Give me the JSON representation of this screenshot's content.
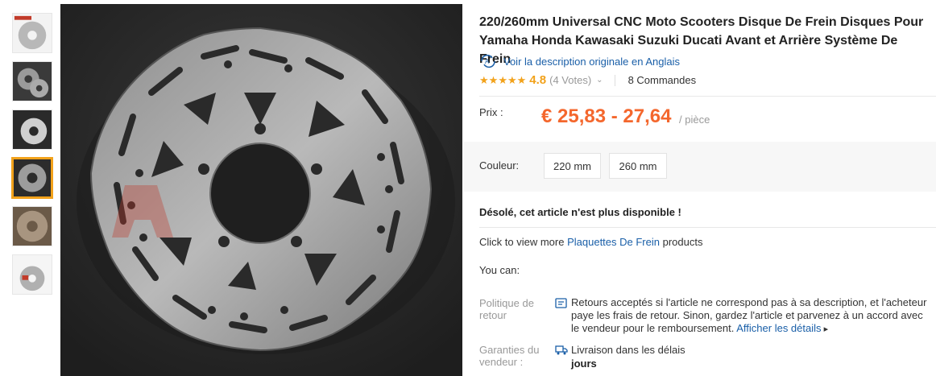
{
  "product": {
    "title": "220/260mm Universal CNC Moto Scooters Disque De Frein Disques Pour Yamaha Honda Kawasaki Suzuki Ducati Avant et Arrière Système De Frein",
    "original_description_link": "Voir la description originale en Anglais",
    "translate_icon": "translate-icon",
    "rating": "4.8",
    "stars": 5,
    "votes": "(4 Votes)",
    "orders": "8 Commandes",
    "price_label": "Prix :",
    "price": "€ 25,83 - 27,64",
    "price_unit": "/ pièce",
    "color_label": "Couleur:",
    "color_options": [
      "220 mm",
      "260 mm"
    ],
    "unavailable_msg": "Désolé, cet article n'est plus disponible !",
    "more_prefix": "Click to view more",
    "more_link": "Plaquettes De Frein",
    "more_suffix": "products",
    "you_can": "You can:",
    "policy_label": "Politique de retour",
    "policy_text": "Retours acceptés si l'article ne correspond pas à sa description, et l'acheteur paye les frais de retour. Sinon, gardez l'article et parvenez à un accord avec le vendeur pour le remboursement.",
    "policy_link": "Afficher les détails",
    "guarantee_label": "Garanties du vendeur :",
    "guarantee_text": "Livraison dans les délais",
    "guarantee_days": "jours"
  },
  "colors": {
    "accent_orange": "#f4672d",
    "star_gold": "#f2a21b",
    "link_blue": "#1a5fa8",
    "muted_gray": "#999999"
  },
  "gallery": {
    "thumbnail_count": 6,
    "active_index": 3
  }
}
